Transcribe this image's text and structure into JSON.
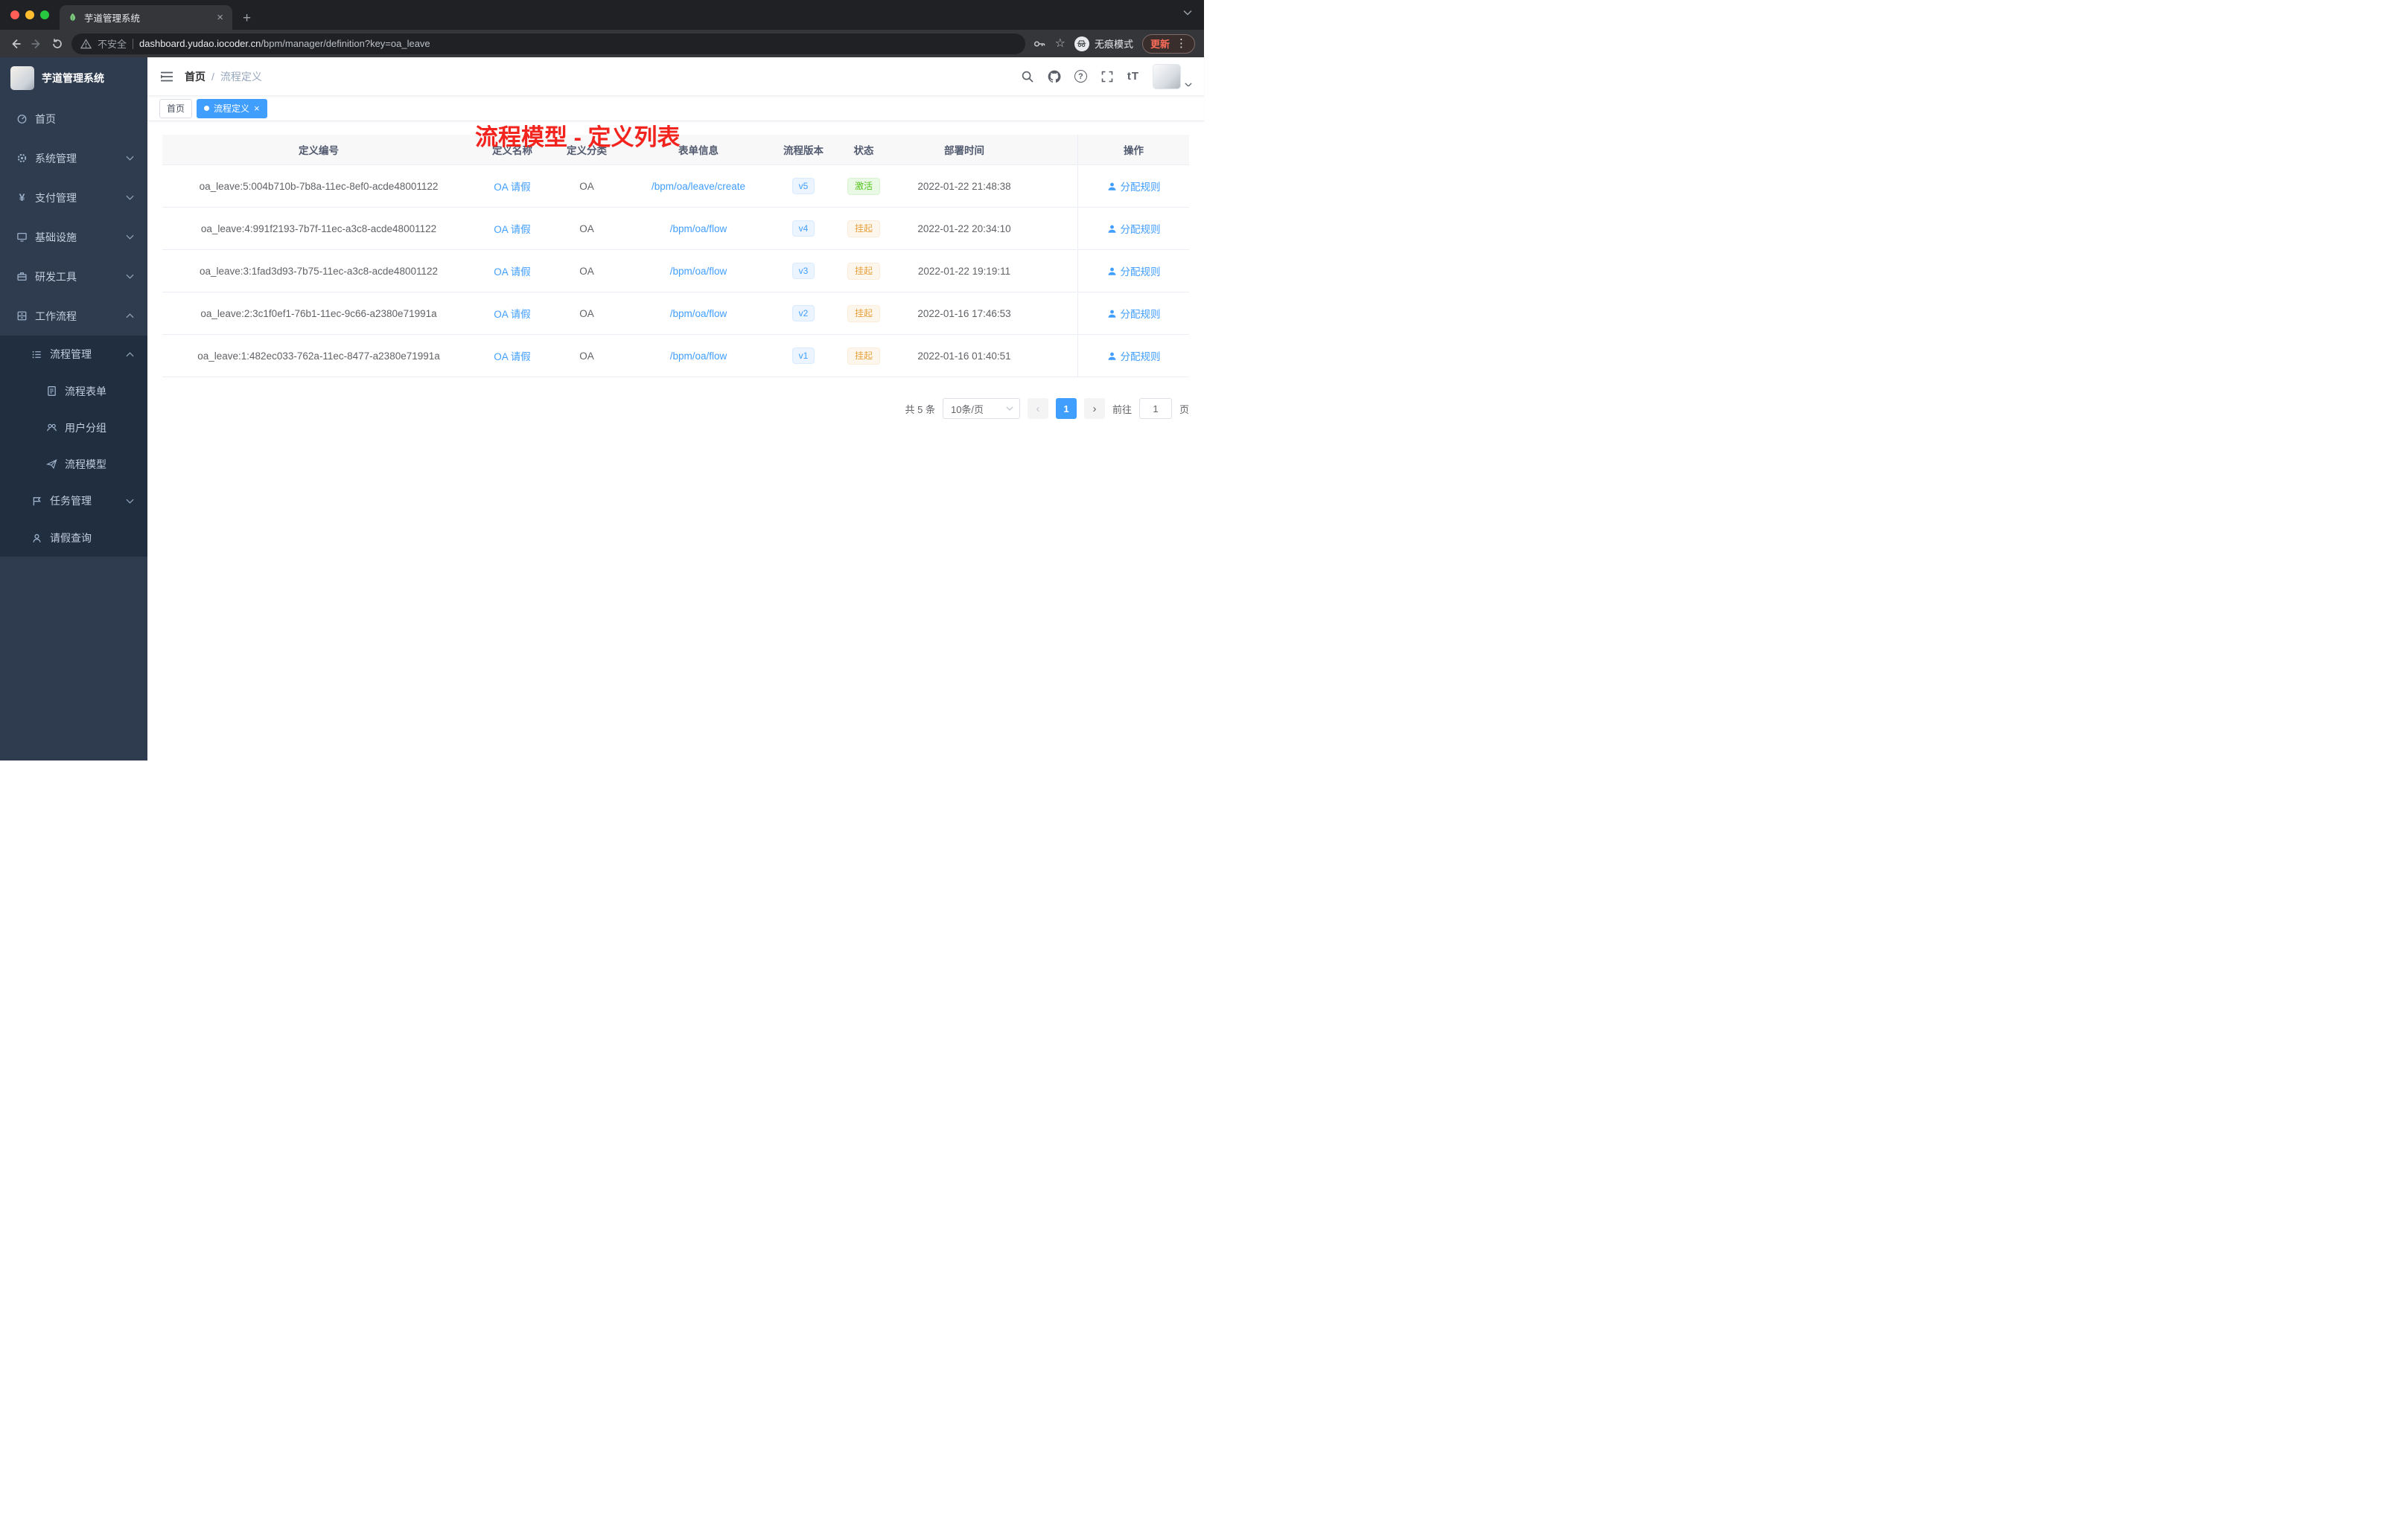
{
  "browser": {
    "tab": {
      "title": "芋道管理系统"
    },
    "toolbar": {
      "security_label": "不安全",
      "url_host": "dashboard.yudao.iocoder.cn",
      "url_path": "/bpm/manager/definition?key=oa_leave",
      "incognito_label": "无痕模式",
      "update_label": "更新"
    }
  },
  "sidebar": {
    "app_title": "芋道管理系统",
    "items": [
      {
        "label": "首页"
      },
      {
        "label": "系统管理"
      },
      {
        "label": "支付管理"
      },
      {
        "label": "基础设施"
      },
      {
        "label": "研发工具"
      },
      {
        "label": "工作流程"
      },
      {
        "label": "流程管理"
      },
      {
        "label": "流程表单"
      },
      {
        "label": "用户分组"
      },
      {
        "label": "流程模型"
      },
      {
        "label": "任务管理"
      },
      {
        "label": "请假查询"
      }
    ]
  },
  "header": {
    "breadcrumb": {
      "home": "首页",
      "separator": "/",
      "current": "流程定义"
    },
    "annotation": "流程模型 - 定义列表",
    "font_size_icon_label": "tT"
  },
  "tags": {
    "home": "首页",
    "active": "流程定义"
  },
  "table": {
    "columns": [
      "定义编号",
      "定义名称",
      "定义分类",
      "表单信息",
      "流程版本",
      "状态",
      "部署时间",
      "操作"
    ],
    "rows": [
      {
        "id": "oa_leave:5:004b710b-7b8a-11ec-8ef0-acde48001122",
        "name": "OA 请假",
        "category": "OA",
        "form": "/bpm/oa/leave/create",
        "version": "v5",
        "status": "激活",
        "status_type": "success",
        "time": "2022-01-22 21:48:38",
        "action": "分配规则"
      },
      {
        "id": "oa_leave:4:991f2193-7b7f-11ec-a3c8-acde48001122",
        "name": "OA 请假",
        "category": "OA",
        "form": "/bpm/oa/flow",
        "version": "v4",
        "status": "挂起",
        "status_type": "warning",
        "time": "2022-01-22 20:34:10",
        "action": "分配规则"
      },
      {
        "id": "oa_leave:3:1fad3d93-7b75-11ec-a3c8-acde48001122",
        "name": "OA 请假",
        "category": "OA",
        "form": "/bpm/oa/flow",
        "version": "v3",
        "status": "挂起",
        "status_type": "warning",
        "time": "2022-01-22 19:19:11",
        "action": "分配规则"
      },
      {
        "id": "oa_leave:2:3c1f0ef1-76b1-11ec-9c66-a2380e71991a",
        "name": "OA 请假",
        "category": "OA",
        "form": "/bpm/oa/flow",
        "version": "v2",
        "status": "挂起",
        "status_type": "warning",
        "time": "2022-01-16 17:46:53",
        "action": "分配规则"
      },
      {
        "id": "oa_leave:1:482ec033-762a-11ec-8477-a2380e71991a",
        "name": "OA 请假",
        "category": "OA",
        "form": "/bpm/oa/flow",
        "version": "v1",
        "status": "挂起",
        "status_type": "warning",
        "time": "2022-01-16 01:40:51",
        "action": "分配规则"
      }
    ]
  },
  "pagination": {
    "total": "共 5 条",
    "page_size": "10条/页",
    "prev": "‹",
    "page": "1",
    "next": "›",
    "goto_prefix": "前往",
    "goto_value": "1",
    "goto_suffix": "页"
  },
  "colors": {
    "accent": "#409eff",
    "success": "#52c41a",
    "warning": "#e6a23c",
    "annotation_red": "#f2241d",
    "sidebar_bg": "#2f3c4f",
    "submenu_bg": "#202e40"
  }
}
